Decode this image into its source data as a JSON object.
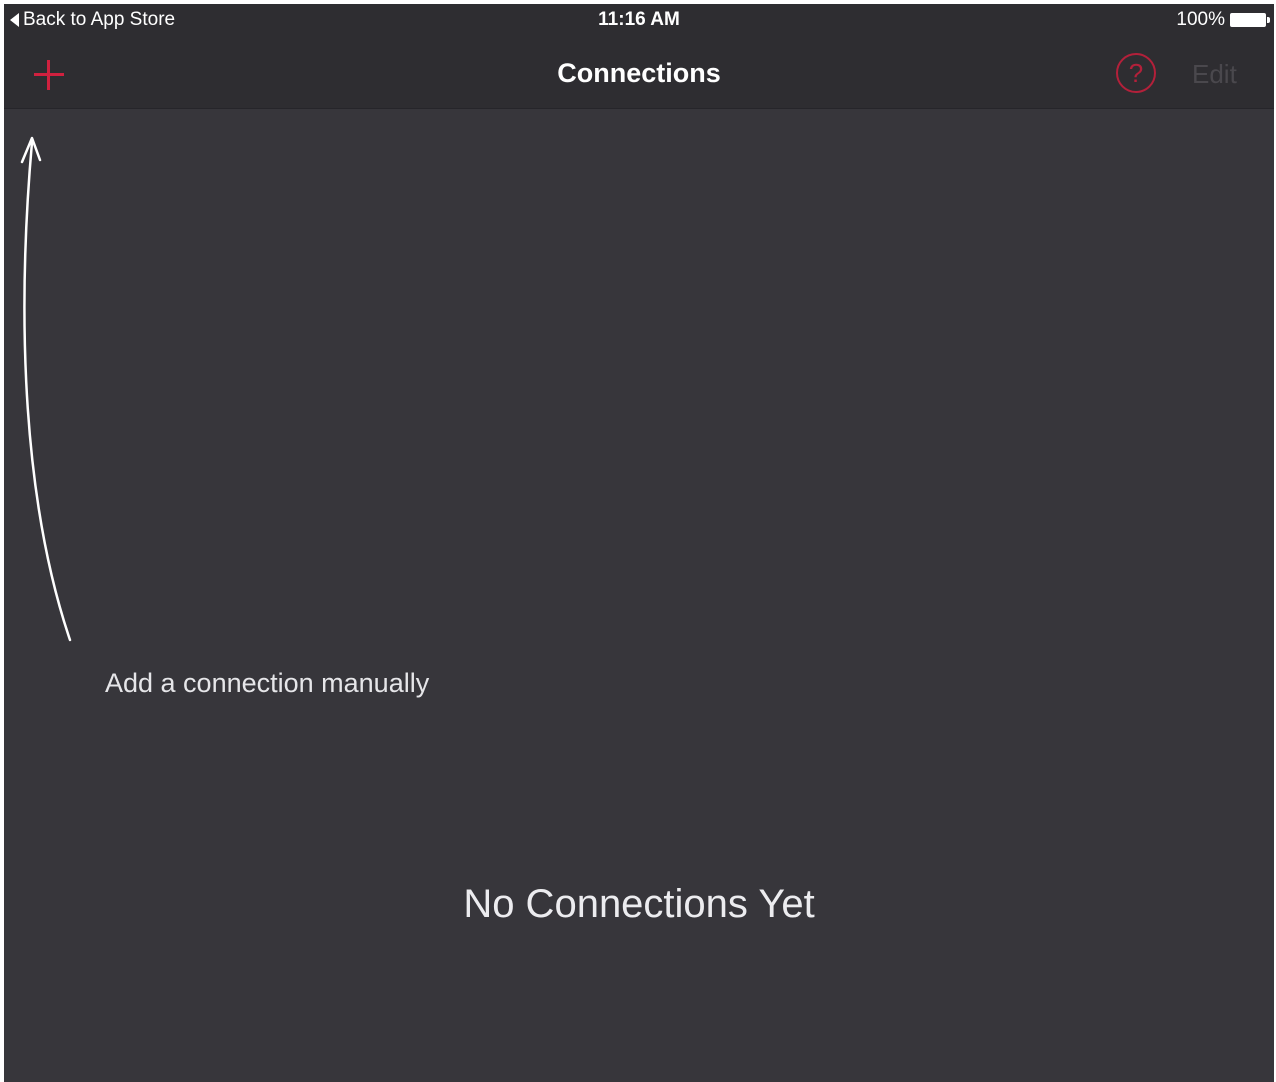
{
  "status_bar": {
    "back_label": "Back to App Store",
    "time": "11:16 AM",
    "battery_percent": "100%",
    "battery_level": 1.0
  },
  "nav_bar": {
    "title": "Connections",
    "add_icon": "plus-icon",
    "help_icon": "question-circle-icon",
    "help_glyph": "?",
    "edit_label": "Edit"
  },
  "content": {
    "hint": "Add a connection manually",
    "empty_message": "No Connections Yet"
  },
  "colors": {
    "background": "#37363b",
    "bar_background": "#2e2d31",
    "accent": "#d0213f",
    "disabled_text": "#4a484d"
  }
}
